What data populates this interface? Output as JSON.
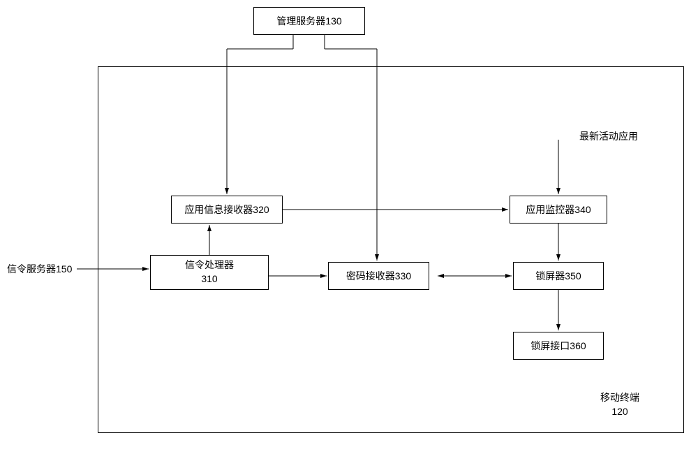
{
  "boxes": {
    "management_server": "管理服务器130",
    "app_info_receiver": "应用信息接收器320",
    "app_monitor": "应用监控器340",
    "signal_processor_l1": "信令处理器",
    "signal_processor_l2": "310",
    "password_receiver": "密码接收器330",
    "lock_screen": "锁屏器350",
    "lock_interface": "锁屏接口360"
  },
  "labels": {
    "signal_server": "信令服务器150",
    "latest_active": "最新活动应用",
    "mobile_terminal_l1": "移动终端",
    "mobile_terminal_l2": "120"
  }
}
